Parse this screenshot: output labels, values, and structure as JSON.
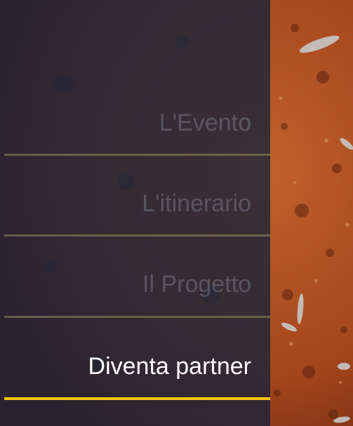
{
  "menu": {
    "items": [
      {
        "label": "L'Evento",
        "active": false
      },
      {
        "label": "L'itinerario",
        "active": false
      },
      {
        "label": "Il Progetto",
        "active": false
      },
      {
        "label": "Diventa partner",
        "active": true
      }
    ]
  },
  "colors": {
    "panel": "#16213a",
    "accent": "#f2c400",
    "soil": "#a84a1e",
    "active_text": "#ffffff"
  }
}
